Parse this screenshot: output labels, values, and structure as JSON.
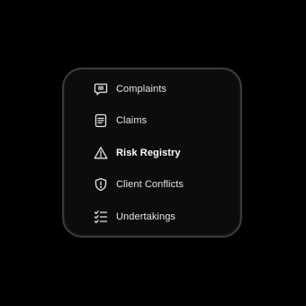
{
  "menu": {
    "items": [
      {
        "label": "Complaints",
        "icon": "message-alert-icon",
        "active": false
      },
      {
        "label": "Claims",
        "icon": "document-lines-icon",
        "active": false
      },
      {
        "label": "Risk Registry",
        "icon": "warning-triangle-icon",
        "active": true
      },
      {
        "label": "Client Conflicts",
        "icon": "shield-alert-icon",
        "active": false
      },
      {
        "label": "Undertakings",
        "icon": "checklist-icon",
        "active": false
      }
    ]
  },
  "colors": {
    "background": "#000000",
    "card": "#0c0c0c",
    "border": "#3a3a3a",
    "text": "#e8e8e8"
  }
}
